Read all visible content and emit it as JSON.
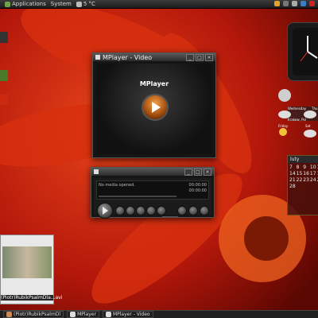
{
  "topbar": {
    "apps_label": "Applications",
    "system_label": "System",
    "temp_label": "5 °C"
  },
  "mplayer_video": {
    "title": "MPlayer - Video",
    "logo_text": "MPlayer"
  },
  "mplayer_controls": {
    "status_text": "No media opened.",
    "time_elapsed": "00:00:00",
    "time_total": "00:00:00"
  },
  "weather": {
    "day1": "Wednesday",
    "day2": "Thu",
    "day3": "Friday",
    "day4": "Sat",
    "location": "Krakow, Pol"
  },
  "calendar": {
    "month": "luty",
    "days": [
      "7",
      "8",
      "9",
      "10",
      "11",
      "14",
      "15",
      "16",
      "17",
      "18",
      "21",
      "22",
      "23",
      "24",
      "25",
      "28"
    ]
  },
  "thumbnail": {
    "label": "(Piotr)RubikPsalmDla...avi"
  },
  "taskbar": {
    "task1": "(Piotr)RubikPsalmDl",
    "task2": "MPlayer",
    "task3": "MPlayer - Video"
  },
  "colors": {
    "wallpaper": "#c51d0b",
    "accent": "#f08a2a"
  }
}
